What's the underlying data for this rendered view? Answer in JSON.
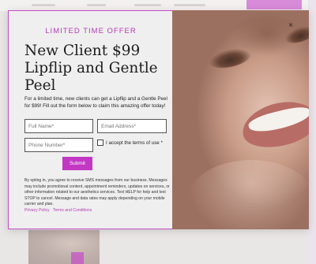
{
  "modal": {
    "eyebrow": "LIMITED TIME OFFER",
    "headline": "New Client $99 Lipflip and Gentle Peel",
    "intro": "For a limited time, new clients can get a Lipflip and a Gentle Peel for $99! Fill out the form below to claim this amazing offer today!",
    "close_icon": "×",
    "fields": {
      "first_name_placeholder": "Full Name*",
      "email_placeholder": "Email Address*",
      "phone_placeholder": "Phone Number*"
    },
    "terms_label": "I accept the terms of use *",
    "terms_checked": false,
    "submit_label": "Submit",
    "disclaimer": "By opting in, you agree to receive SMS messages from our business. Messages may include promotional content, appointment reminders, updates on services, or other information related to our aesthetics services. Text HELP for help and text STOP to cancel. Message and data rates may apply depending on your mobile carrier and plan.",
    "links": {
      "privacy": "Privacy Policy",
      "terms": "Terms and Conditions"
    }
  },
  "colors": {
    "accent": "#c238c4",
    "modal_background": "#efefef",
    "page_background": "#e9e6e6"
  },
  "icons": {
    "close": "close-icon",
    "checkbox": "checkbox-icon"
  }
}
